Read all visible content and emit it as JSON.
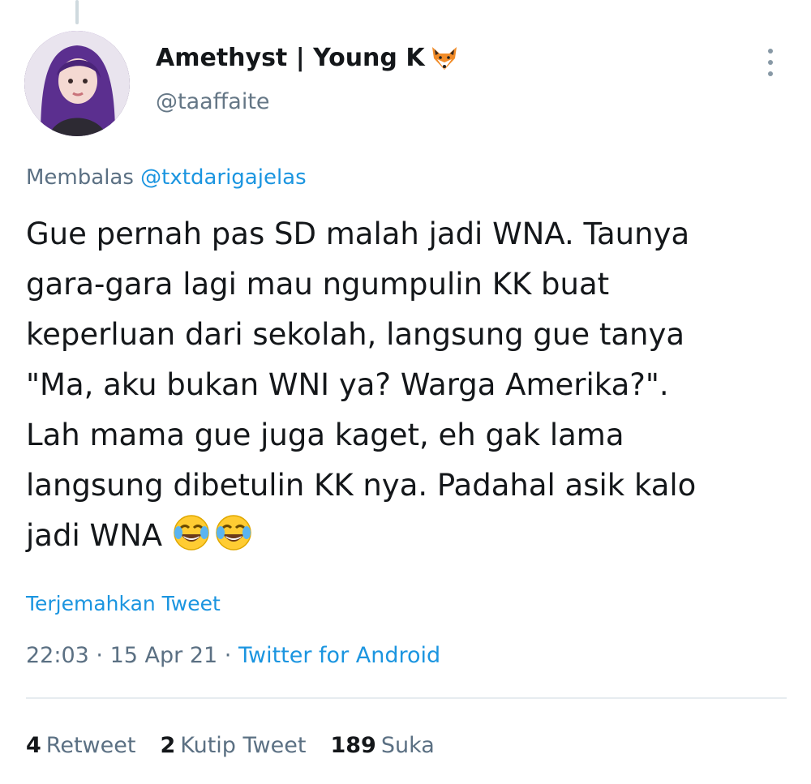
{
  "tweet": {
    "display_name": "Amethyst | Young K",
    "name_emoji_icon": "fox-face-icon",
    "handle": "@taaffaite",
    "reply_prefix": "Membalas",
    "reply_to": "@txtdarigajelas",
    "text": "Gue pernah pas SD malah jadi WNA. Taunya\ngara-gara lagi mau ngumpulin KK buat\nkeperluan dari sekolah, langsung gue tanya\n\"Ma, aku bukan WNI ya? Warga Amerika?\".\nLah mama gue juga kaget, eh gak lama\nlangsung dibetulin KK nya. Padahal asik kalo\njadi WNA",
    "text_emoji_icon": "face-with-tears-of-joy-icon",
    "translate_label": "Terjemahkan Tweet",
    "time": "22:03",
    "date": "15 Apr 21",
    "source": "Twitter for Android",
    "separator": "·"
  },
  "stats": {
    "retweets": {
      "count": "4",
      "label": "Retweet"
    },
    "quotes": {
      "count": "2",
      "label": "Kutip Tweet"
    },
    "likes": {
      "count": "189",
      "label": "Suka"
    }
  },
  "colors": {
    "link": "#1b95e0",
    "secondary_text": "#5b7083",
    "primary_text": "#14171a"
  }
}
